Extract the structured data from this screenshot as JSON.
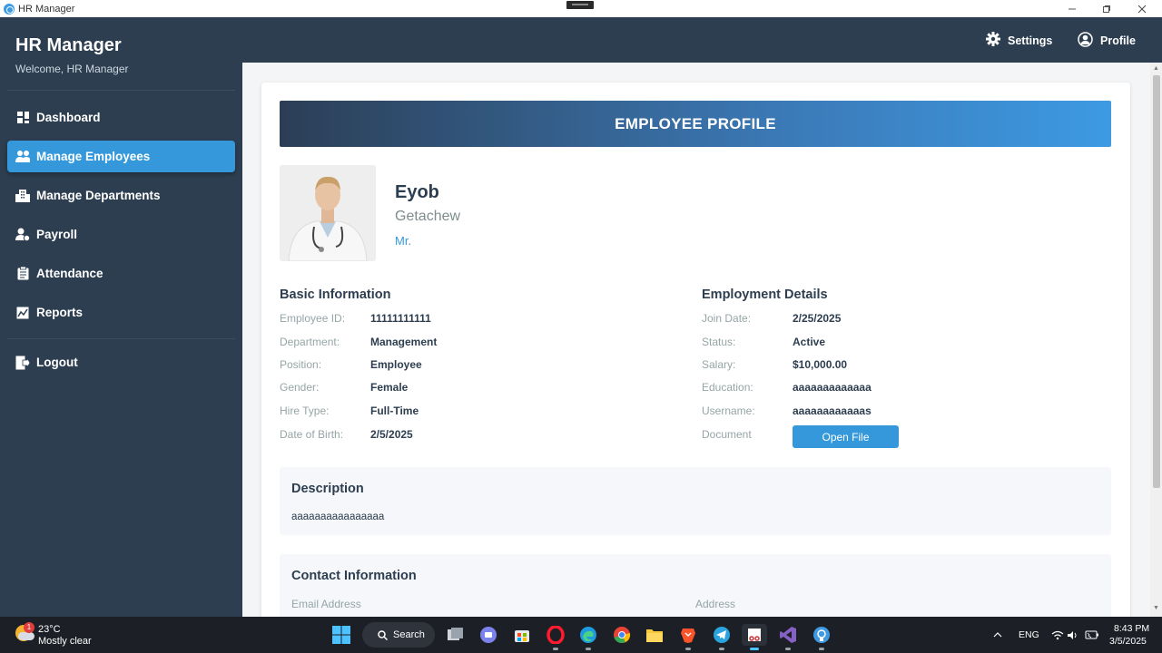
{
  "window": {
    "title": "HR Manager"
  },
  "sidebar": {
    "brand": "HR Manager",
    "welcome": "Welcome, HR Manager",
    "items": [
      {
        "label": "Dashboard",
        "icon": "dashboard-icon",
        "active": false
      },
      {
        "label": "Manage Employees",
        "icon": "users-icon",
        "active": true
      },
      {
        "label": "Manage Departments",
        "icon": "building-icon",
        "active": false
      },
      {
        "label": "Payroll",
        "icon": "payroll-icon",
        "active": false
      },
      {
        "label": "Attendance",
        "icon": "clipboard-icon",
        "active": false
      },
      {
        "label": "Reports",
        "icon": "chart-icon",
        "active": false
      }
    ],
    "logout": "Logout"
  },
  "header": {
    "settings": "Settings",
    "profile": "Profile"
  },
  "profile": {
    "banner": "EMPLOYEE PROFILE",
    "first_name": "Eyob",
    "last_name": "Getachew",
    "title": "Mr."
  },
  "basic": {
    "heading": "Basic Information",
    "fields": [
      {
        "label": "Employee ID:",
        "value": "11111111111"
      },
      {
        "label": "Department:",
        "value": "Management"
      },
      {
        "label": "Position:",
        "value": "Employee"
      },
      {
        "label": "Gender:",
        "value": "Female"
      },
      {
        "label": "Hire Type:",
        "value": "Full-Time"
      },
      {
        "label": "Date of Birth:",
        "value": "2/5/2025"
      }
    ]
  },
  "employment": {
    "heading": "Employment Details",
    "fields": [
      {
        "label": "Join Date:",
        "value": "2/25/2025"
      },
      {
        "label": "Status:",
        "value": "Active"
      },
      {
        "label": "Salary:",
        "value": "$10,000.00"
      },
      {
        "label": "Education:",
        "value": "aaaaaaaaaaaaa"
      },
      {
        "label": "Username:",
        "value": "aaaaaaaaaaaas"
      }
    ],
    "document_label": "Document",
    "open_file": "Open File"
  },
  "description": {
    "heading": "Description",
    "text": "aaaaaaaaaaaaaaaa"
  },
  "contact": {
    "heading": "Contact Information",
    "email_label": "Email Address",
    "address_label": "Address"
  },
  "taskbar": {
    "weather_temp": "23°C",
    "weather_cond": "Mostly clear",
    "weather_badge": "1",
    "search": "Search",
    "lang": "ENG",
    "time": "8:43 PM",
    "date": "3/5/2025"
  },
  "colors": {
    "sidebar": "#2d3e50",
    "accent": "#3498db",
    "text_dark": "#2d3e50",
    "label_gray": "#95a5a6"
  }
}
